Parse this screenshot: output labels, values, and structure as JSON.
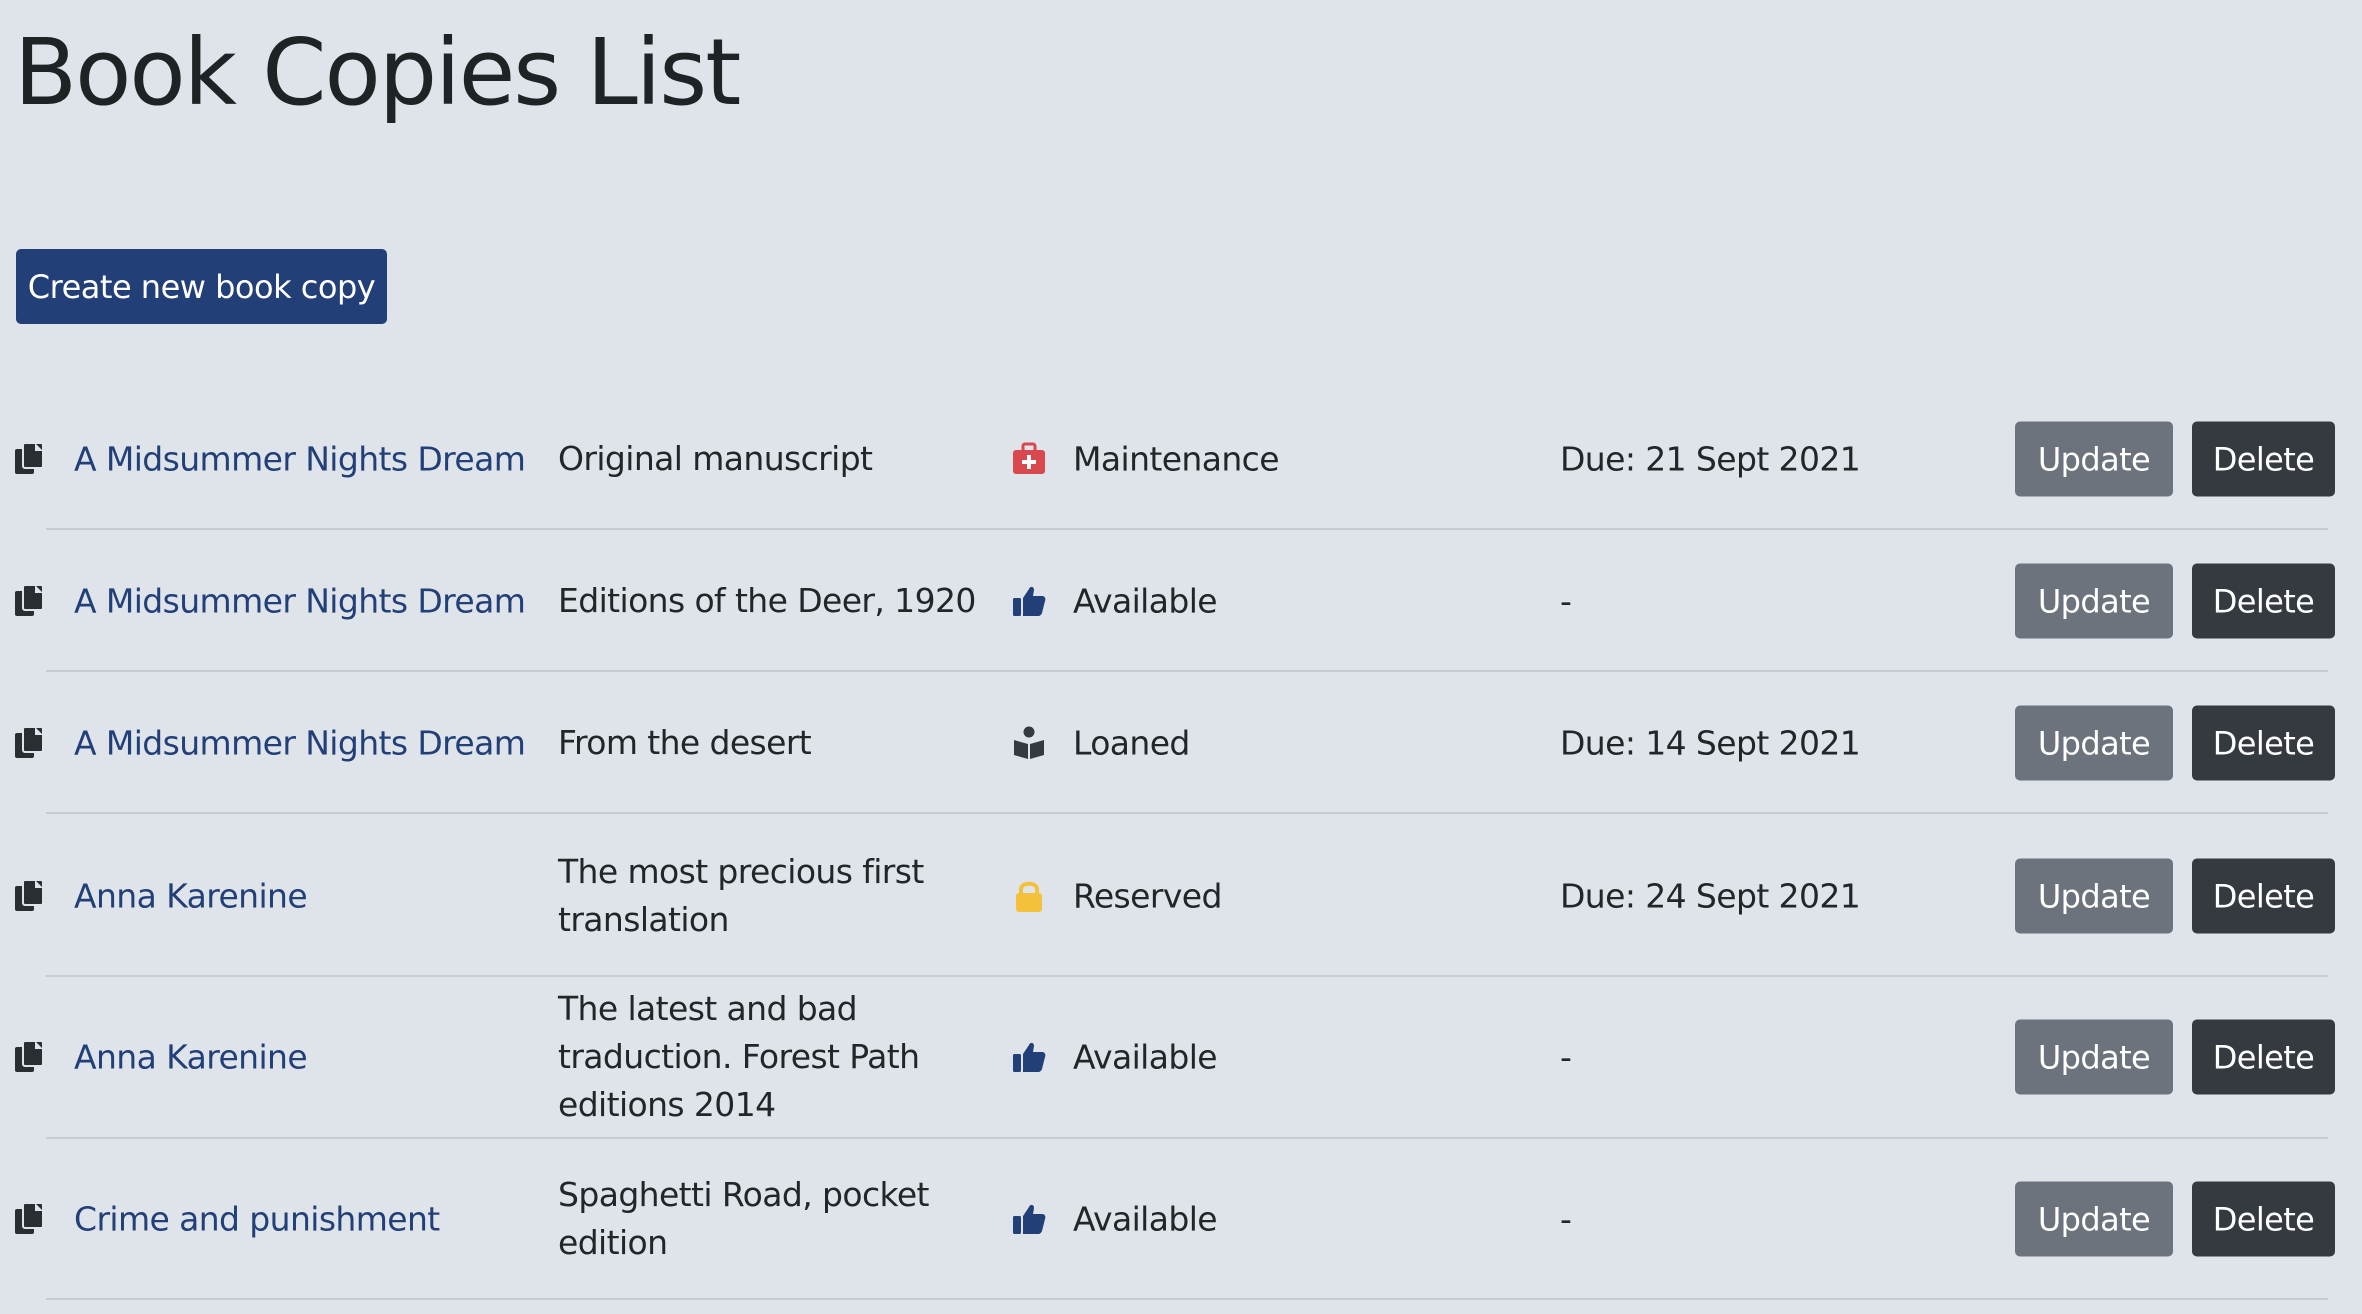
{
  "page": {
    "title": "Book Copies List",
    "create_button": "Create new book copy"
  },
  "colors": {
    "background": "#dfe4eb",
    "primary": "#223f78",
    "update_button": "#6c737c",
    "delete_button": "#343a40",
    "maintenance_icon": "#d9474f",
    "available_icon": "#223f78",
    "loaned_icon": "#343a40",
    "reserved_icon": "#f3c13a"
  },
  "copies": [
    {
      "book": "A Midsummer Nights Dream",
      "edition": "Original manuscript",
      "status": "Maintenance",
      "status_icon": "first-aid-kit-icon",
      "due": "Due: 21 Sept 2021",
      "update_label": "Update",
      "delete_label": "Delete"
    },
    {
      "book": "A Midsummer Nights Dream",
      "edition": "Editions of the Deer, 1920",
      "status": "Available",
      "status_icon": "thumbs-up-icon",
      "due": "-",
      "update_label": "Update",
      "delete_label": "Delete"
    },
    {
      "book": "A Midsummer Nights Dream",
      "edition": "From the desert",
      "status": "Loaned",
      "status_icon": "person-reading-icon",
      "due": "Due: 14 Sept 2021",
      "update_label": "Update",
      "delete_label": "Delete"
    },
    {
      "book": "Anna Karenine",
      "edition": "The most precious first translation",
      "status": "Reserved",
      "status_icon": "lock-icon",
      "due": "Due: 24 Sept 2021",
      "update_label": "Update",
      "delete_label": "Delete"
    },
    {
      "book": "Anna Karenine",
      "edition": "The latest and bad traduction. Forest Path editions 2014",
      "status": "Available",
      "status_icon": "thumbs-up-icon",
      "due": "-",
      "update_label": "Update",
      "delete_label": "Delete"
    },
    {
      "book": "Crime and punishment",
      "edition": "Spaghetti Road, pocket edition",
      "status": "Available",
      "status_icon": "thumbs-up-icon",
      "due": "-",
      "update_label": "Update",
      "delete_label": "Delete"
    }
  ]
}
